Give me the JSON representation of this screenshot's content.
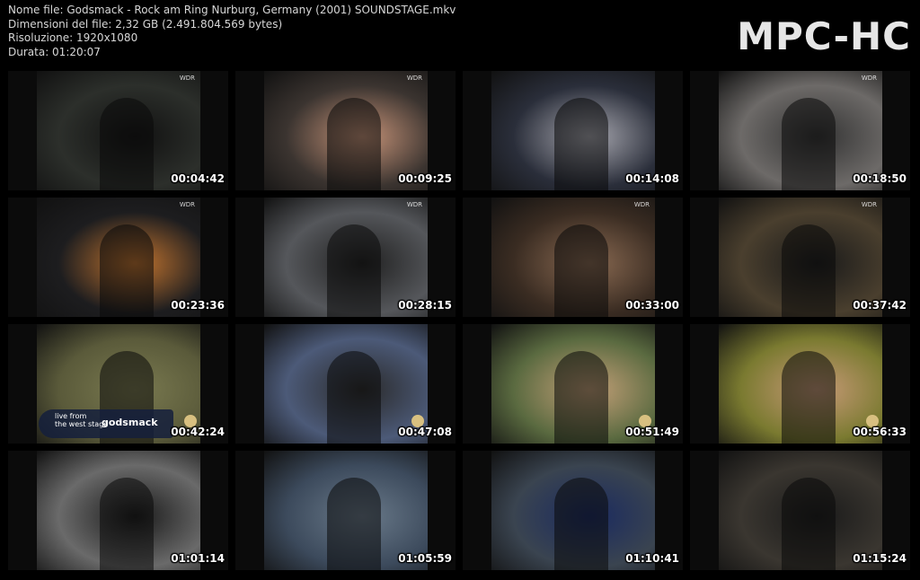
{
  "header": {
    "file_name": "Nome file: Godsmack - Rock am Ring Nurburg, Germany (2001) SOUNDSTAGE.mkv",
    "file_size": "Dimensioni del file: 2,32 GB (2.491.804.569 bytes)",
    "resolution": "Risoluzione: 1920x1080",
    "duration": "Durata: 01:20:07"
  },
  "logo": "MPC-HC",
  "thumbnails": [
    {
      "time": "00:04:42",
      "bg": "#2c2f2b",
      "accent": "#111111",
      "logo": "WDR"
    },
    {
      "time": "00:09:25",
      "bg": "#3b3430",
      "accent": "#c69378",
      "logo": "WDR"
    },
    {
      "time": "00:14:08",
      "bg": "#2a2e3a",
      "accent": "#a8a8b0",
      "logo": ""
    },
    {
      "time": "00:18:50",
      "bg": "#6d6a68",
      "accent": "#333333",
      "logo": "WDR"
    },
    {
      "time": "00:23:36",
      "bg": "#1d1d1f",
      "accent": "#c4752f",
      "logo": "WDR"
    },
    {
      "time": "00:28:15",
      "bg": "#55575b",
      "accent": "#202020",
      "logo": "WDR"
    },
    {
      "time": "00:33:00",
      "bg": "#3a2c22",
      "accent": "#8a6a52",
      "logo": "WDR"
    },
    {
      "time": "00:37:42",
      "bg": "#4a3f2e",
      "accent": "#1a1a1a",
      "logo": "WDR"
    },
    {
      "time": "00:42:24",
      "bg": "#5a5a3a",
      "accent": "#7a7a50",
      "logo": ""
    },
    {
      "time": "00:47:08",
      "bg": "#4c5a78",
      "accent": "#2a2a2a",
      "logo": ""
    },
    {
      "time": "00:51:49",
      "bg": "#5a6a40",
      "accent": "#c4a078",
      "logo": ""
    },
    {
      "time": "00:56:33",
      "bg": "#7a7a30",
      "accent": "#c89a78",
      "logo": ""
    },
    {
      "time": "01:01:14",
      "bg": "#6a6a6a",
      "accent": "#1a1a1a",
      "logo": ""
    },
    {
      "time": "01:05:59",
      "bg": "#3c4a5c",
      "accent": "#6a7a8a",
      "logo": ""
    },
    {
      "time": "01:10:41",
      "bg": "#3a4450",
      "accent": "#1a2a60",
      "logo": ""
    },
    {
      "time": "01:15:24",
      "bg": "#3a3630",
      "accent": "#1a1a1a",
      "logo": ""
    }
  ],
  "caption_overlay": {
    "line1": "live from",
    "line2": "the west stage",
    "brand": "godsmack"
  }
}
